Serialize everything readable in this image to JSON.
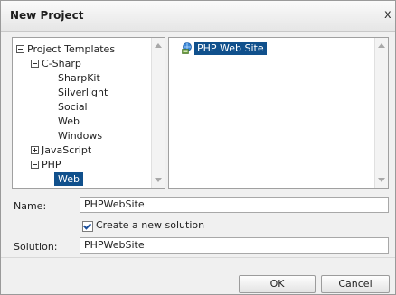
{
  "dialog": {
    "title": "New Project",
    "close_glyph": "x"
  },
  "tree": {
    "root": "Project Templates",
    "csharp": "C-Sharp",
    "csharp_children": [
      "SharpKit",
      "Silverlight",
      "Social",
      "Web",
      "Windows"
    ],
    "javascript": "JavaScript",
    "php": "PHP",
    "php_selected": "Web"
  },
  "files": {
    "selected": "PHP Web Site",
    "icon": "php-web-site-icon"
  },
  "form": {
    "name_label": "Name:",
    "name_value": "PHPWebSite",
    "create_solution_label": "Create a new solution",
    "create_solution_checked": true,
    "solution_label": "Solution:",
    "solution_value": "PHPWebSite"
  },
  "buttons": {
    "ok": "OK",
    "cancel": "Cancel"
  },
  "colors": {
    "selection": "#10508c"
  }
}
